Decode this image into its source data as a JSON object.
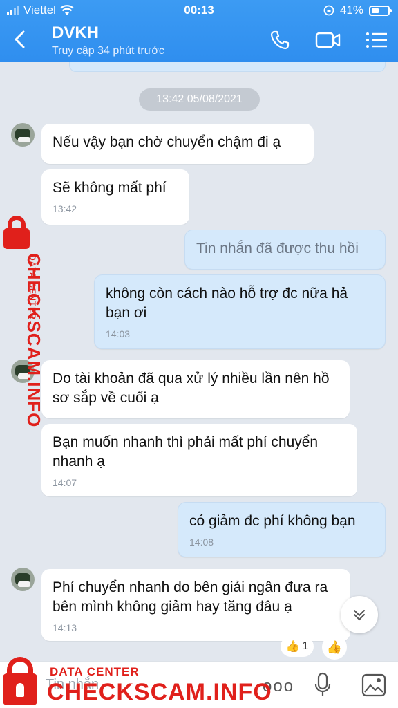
{
  "status_bar": {
    "carrier": "Viettel",
    "time": "00:13",
    "battery": "41%"
  },
  "header": {
    "contact_name": "DVKH",
    "last_seen": "Truy cập 34 phút trước"
  },
  "chat": {
    "date_separator": "13:42 05/08/2021",
    "messages": [
      {
        "sender": "them",
        "text": "Nếu vậy bạn chờ chuyển chậm đi ạ",
        "time": ""
      },
      {
        "sender": "them",
        "text": "Sẽ không mất phí",
        "time": "13:42"
      },
      {
        "sender": "me",
        "text": "Tin nhắn đã được thu hồi",
        "time": ""
      },
      {
        "sender": "me",
        "text": "không còn cách nào hỗ trợ đc nữa hả bạn ơi",
        "time": "14:03"
      },
      {
        "sender": "them",
        "text": "Do tài khoản đã qua xử lý nhiều lần nên hồ sơ sắp về cuối ạ",
        "time": ""
      },
      {
        "sender": "them",
        "text": "Bạn muốn nhanh thì phải mất phí chuyển nhanh ạ",
        "time": "14:07"
      },
      {
        "sender": "me",
        "text": "có giảm đc phí không bạn",
        "time": "14:08"
      },
      {
        "sender": "them",
        "text": "Phí chuyển nhanh do bên giải ngân đưa ra bên mình không giảm hay tăng đâu ạ",
        "time": "14:13"
      }
    ],
    "reaction": {
      "emoji": "👍",
      "count": "1"
    },
    "react_button_emoji": "👍"
  },
  "composer": {
    "placeholder": "Tin nhắn",
    "more_label": "ooo"
  },
  "watermark": {
    "label": "DATA CENTER",
    "brand": "CHECKSCAM.INFO"
  },
  "colors": {
    "header": "#2f8eef",
    "my_bubble": "#d5e9fb",
    "watermark": "#e0201b",
    "background": "#e2e7ee"
  }
}
